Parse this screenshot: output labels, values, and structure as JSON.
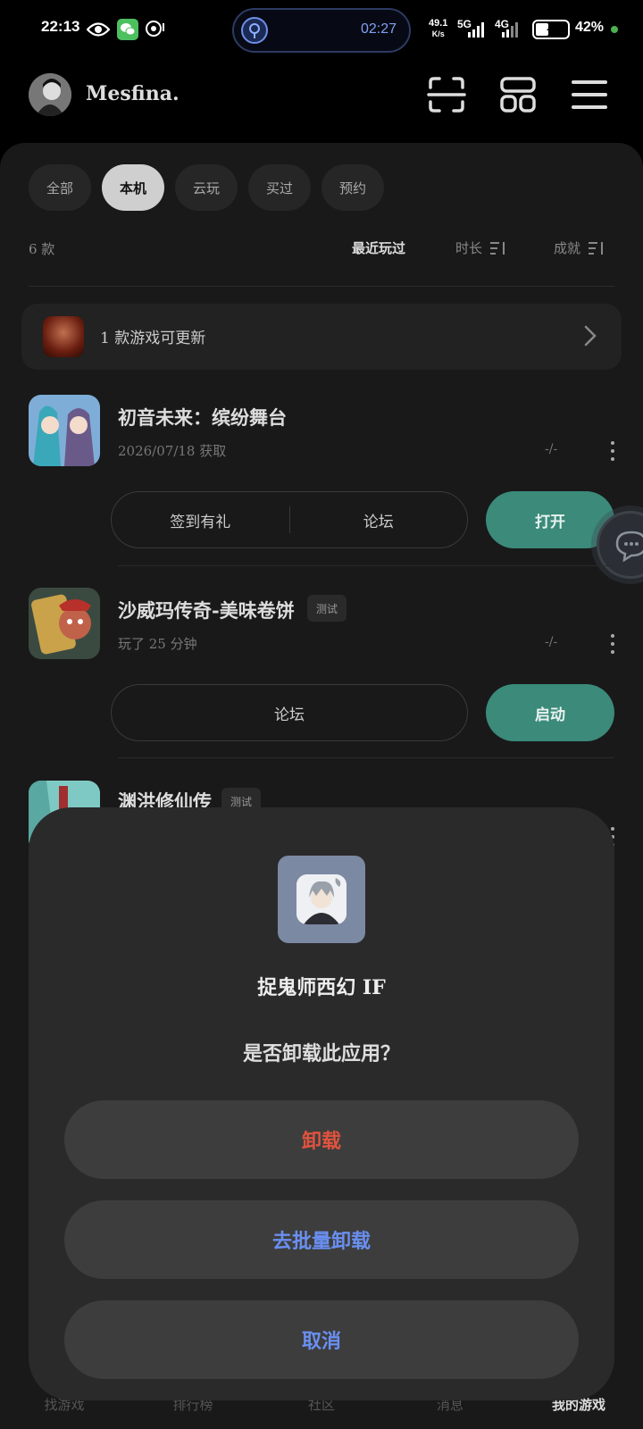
{
  "status_bar": {
    "time": "22:13",
    "pill_time": "02:27",
    "net_speed_value": "49.1",
    "net_speed_unit": "K/s",
    "signal1": "5G",
    "signal2": "4G",
    "battery_pct": "42%",
    "battery_level": 0.42
  },
  "header": {
    "username": "Mesfina."
  },
  "filters": {
    "chips": [
      "全部",
      "本机",
      "云玩",
      "买过",
      "预约"
    ],
    "active": "本机"
  },
  "list_meta": {
    "count": "6 款",
    "sort_recent": "最近玩过",
    "sort_duration": "时长",
    "sort_achievement": "成就"
  },
  "update_banner": {
    "text": "1 款游戏可更新"
  },
  "games": [
    {
      "title": "初音未来：缤纷舞台",
      "subtitle": "2026/07/18 获取",
      "progress": "-/-",
      "buttons": [
        "签到有礼",
        "论坛"
      ],
      "action": "打开"
    },
    {
      "title": "沙威玛传奇-美味卷饼",
      "tag": "测试",
      "subtitle": "玩了 25 分钟",
      "progress": "-/-",
      "buttons": [
        "论坛"
      ],
      "action": "启动"
    },
    {
      "title": "渊洪修仙传",
      "tag": "测试"
    }
  ],
  "bottom_nav": [
    "找游戏",
    "排行榜",
    "社区",
    "消息",
    "我的游戏"
  ],
  "dialog": {
    "app_name": "捉鬼师西幻 IF",
    "question": "是否卸载此应用？",
    "uninstall": "卸载",
    "batch_uninstall": "去批量卸载",
    "cancel": "取消"
  },
  "colors": {
    "accent_green": "#3b8a7a",
    "danger_red": "#e0533f",
    "link_blue": "#6a8ff0"
  }
}
